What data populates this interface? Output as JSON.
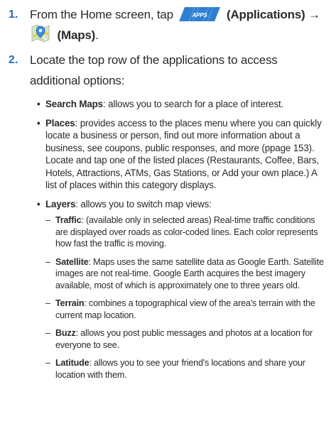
{
  "step1": {
    "number": "1.",
    "pre": "From the Home screen, tap",
    "apps_icon_text": "APPS",
    "applications_label": "(Applications)",
    "arrow": "→",
    "maps_label": "(Maps)",
    "end": "."
  },
  "step2": {
    "number": "2.",
    "text": "Locate the top row of the applications to access additional options:"
  },
  "bullets": [
    {
      "term": "Search Maps",
      "text": ": allows you to search for a place of interest."
    },
    {
      "term": "Places",
      "text": ": provides access to the places menu where you can quickly locate a business or person, find out more information about a business, see coupons, public responses, and more (ppage 153). Locate and tap one of the listed places (Restaurants, Coffee, Bars, Hotels, Attractions, ATMs, Gas Stations, or Add your own place.) A list of places within this category displays."
    },
    {
      "term": "Layers",
      "text": ": allows you to switch map views:"
    }
  ],
  "layers": [
    {
      "term": "Traffic",
      "text": ": (available only in selected areas) Real-time traffic conditions are displayed over roads as color-coded lines. Each color represents how fast the traffic is moving."
    },
    {
      "term": "Satellite",
      "text": ": Maps uses the same satellite data as Google Earth. Satellite images are not real-time. Google Earth acquires the best imagery available, most of which is approximately one to three years old."
    },
    {
      "term": "Terrain",
      "text": ": combines a topographical view of the area's terrain with the current map location."
    },
    {
      "term": "Buzz",
      "text": ": allows you post public messages and photos at a location for everyone to see."
    },
    {
      "term": "Latitude",
      "text": ": allows you to see your friend's locations and share your location with them."
    }
  ],
  "symbols": {
    "bullet": "•",
    "dash": "–"
  },
  "colors": {
    "step_number": "#2a6fb4",
    "apps_icon": "#2f7fd0",
    "text": "#2a2a2a"
  },
  "icons": {
    "apps": "apps-icon",
    "maps": "maps-icon"
  }
}
